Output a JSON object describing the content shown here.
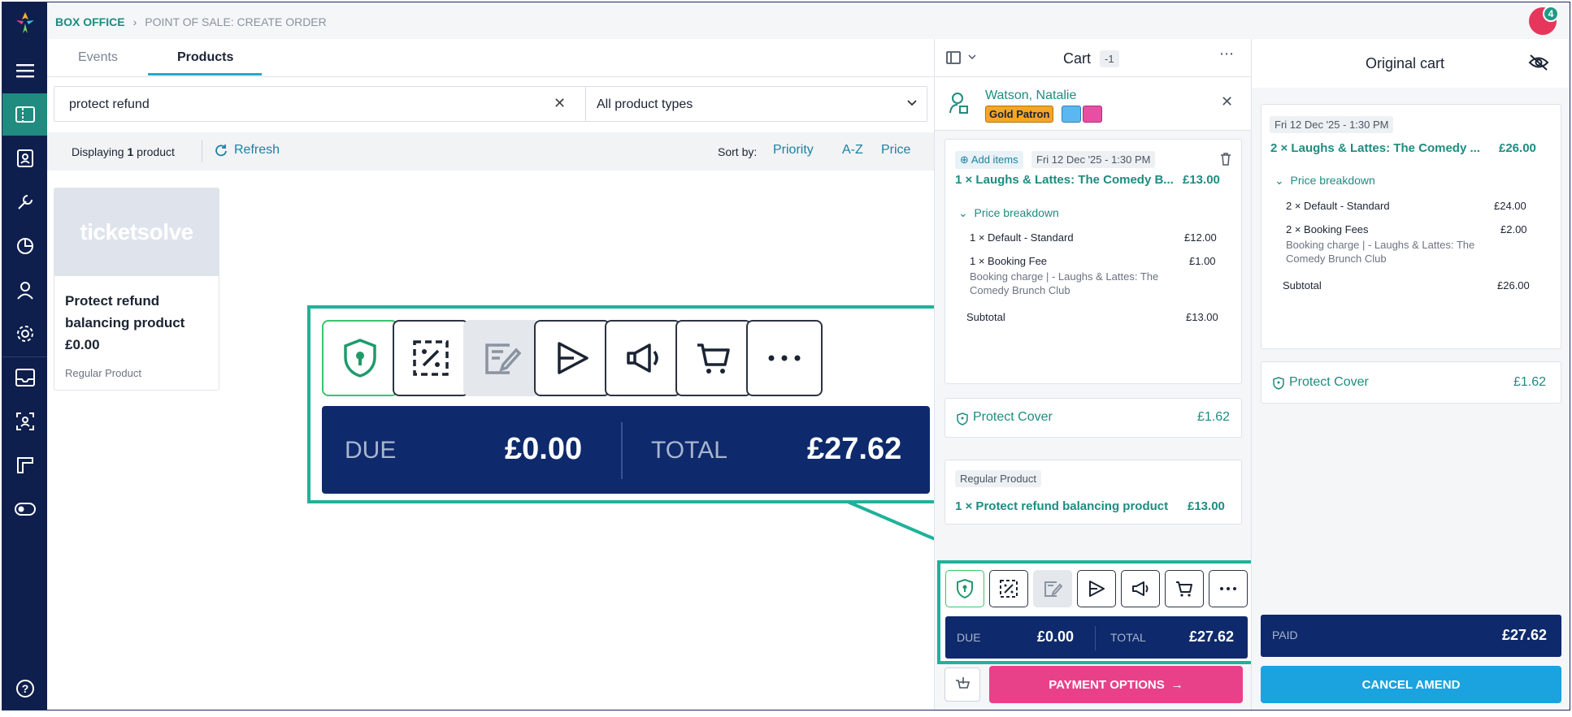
{
  "breadcrumb": {
    "root": "BOX OFFICE",
    "current": "POINT OF SALE: CREATE ORDER"
  },
  "notifications": {
    "count": "4"
  },
  "tabs": [
    {
      "label": "Events"
    },
    {
      "label": "Products"
    }
  ],
  "search": {
    "value": "protect refund"
  },
  "product_type_select": {
    "value": "All product types"
  },
  "toolbar": {
    "displaying_prefix": "Displaying",
    "displaying_count": "1",
    "displaying_suffix": "product",
    "refresh_label": "Refresh",
    "sort_label": "Sort by:",
    "sort_options": [
      "Priority",
      "A-Z",
      "Price"
    ]
  },
  "product_card": {
    "logo_text": "ticketsolve",
    "name": "Protect refund balancing product",
    "price": "£0.00",
    "type": "Regular Product"
  },
  "cart": {
    "title": "Cart",
    "count": "-1",
    "customer": {
      "name": "Watson, Natalie",
      "tag": "Gold Patron"
    },
    "event_line": {
      "add_items": "Add items",
      "date": "Fri 12 Dec '25 - 1:30 PM",
      "item": "1 × Laughs & Lattes: The Comedy B...",
      "item_price": "£13.00",
      "breakdown_label": "Price breakdown",
      "rows": [
        {
          "label": "1 × Default - Standard",
          "price": "£12.00"
        },
        {
          "label": "1 × Booking Fee",
          "price": "£1.00",
          "sub": "Booking charge | - Laughs & Lattes: The Comedy Brunch Club"
        }
      ],
      "subtotal_label": "Subtotal",
      "subtotal": "£13.00"
    },
    "protect": {
      "label": "Protect Cover",
      "price": "£1.62"
    },
    "regular": {
      "chip": "Regular Product",
      "item": "1 × Protect refund balancing product",
      "price": "£13.00"
    },
    "totals": {
      "due_label": "DUE",
      "due": "£0.00",
      "total_label": "TOTAL",
      "total": "£27.62"
    },
    "payment_label": "PAYMENT OPTIONS"
  },
  "original_cart": {
    "title": "Original cart",
    "date": "Fri 12 Dec '25 - 1:30 PM",
    "item": "2 × Laughs & Lattes: The Comedy ...",
    "item_price": "£26.00",
    "breakdown_label": "Price breakdown",
    "rows": [
      {
        "label": "2 × Default - Standard",
        "price": "£24.00"
      },
      {
        "label": "2 × Booking Fees",
        "price": "£2.00",
        "sub": "Booking charge | - Laughs & Lattes: The Comedy Brunch Club"
      }
    ],
    "subtotal_label": "Subtotal",
    "subtotal": "£26.00",
    "protect": {
      "label": "Protect Cover",
      "price": "£1.62"
    },
    "paid_label": "PAID",
    "paid": "£27.62",
    "cancel_label": "CANCEL AMEND"
  },
  "callout": {
    "due_label": "DUE",
    "due": "£0.00",
    "total_label": "TOTAL",
    "total": "£27.62"
  },
  "colors": {
    "nav": "#0e1f4d",
    "accent_teal": "#1e8c80",
    "payment": "#e8418a",
    "cancel": "#1aa3df",
    "totals_bar": "#0e2a6c",
    "callout_border": "#1fb29a"
  }
}
